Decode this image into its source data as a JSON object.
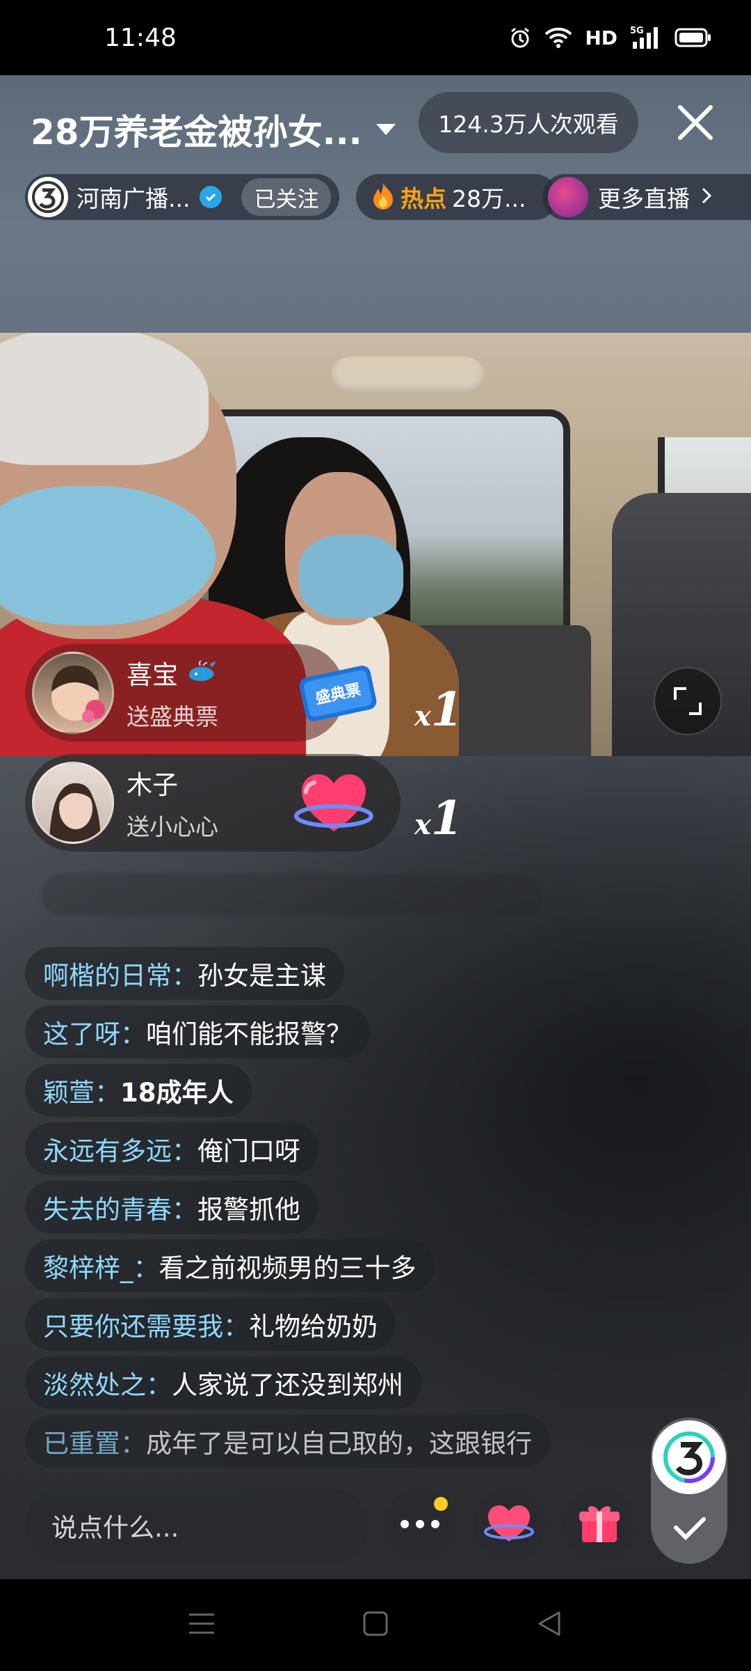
{
  "status_bar": {
    "time": "11:48",
    "hd": "HD",
    "network": "5G"
  },
  "header": {
    "title": "28万养老金被孙女...",
    "viewers": "124.3万人次观看"
  },
  "channel": {
    "name": "河南广播...",
    "follow_label": "已关注"
  },
  "hot": {
    "label": "热点",
    "text": "28万..."
  },
  "more_live": "更多直播",
  "gifts": [
    {
      "user": "喜宝",
      "desc": "送盛典票",
      "gift_name": "盛典票",
      "count_x": "x",
      "count": "1"
    },
    {
      "user": "木子",
      "desc": "送小心心",
      "count_x": "x",
      "count": "1"
    }
  ],
  "comments": [
    {
      "user": "啊楷的日常：",
      "text": "孙女是主谋"
    },
    {
      "user": "这了呀：",
      "text": "咱们能不能报警？"
    },
    {
      "user": "颖萱：",
      "text": "18成年人"
    },
    {
      "user": "永远有多远：",
      "text": "俺门口呀"
    },
    {
      "user": "失去的青春：",
      "text": "报警抓他"
    },
    {
      "user": "黎梓梓_：",
      "text": "看之前视频男的三十多"
    },
    {
      "user": "只要你还需要我：",
      "text": "礼物给奶奶"
    },
    {
      "user": "淡然处之：",
      "text": "人家说了还没到郑州"
    },
    {
      "user": "已重置：",
      "text": "成年了是可以自己取的，这跟银行"
    }
  ],
  "input": {
    "placeholder": "说点什么..."
  },
  "colors": {
    "comment_user": "#8fd8ff",
    "hot_label": "#ffa319",
    "verified": "#28a8e8",
    "notify_dot": "#ffcc26"
  }
}
